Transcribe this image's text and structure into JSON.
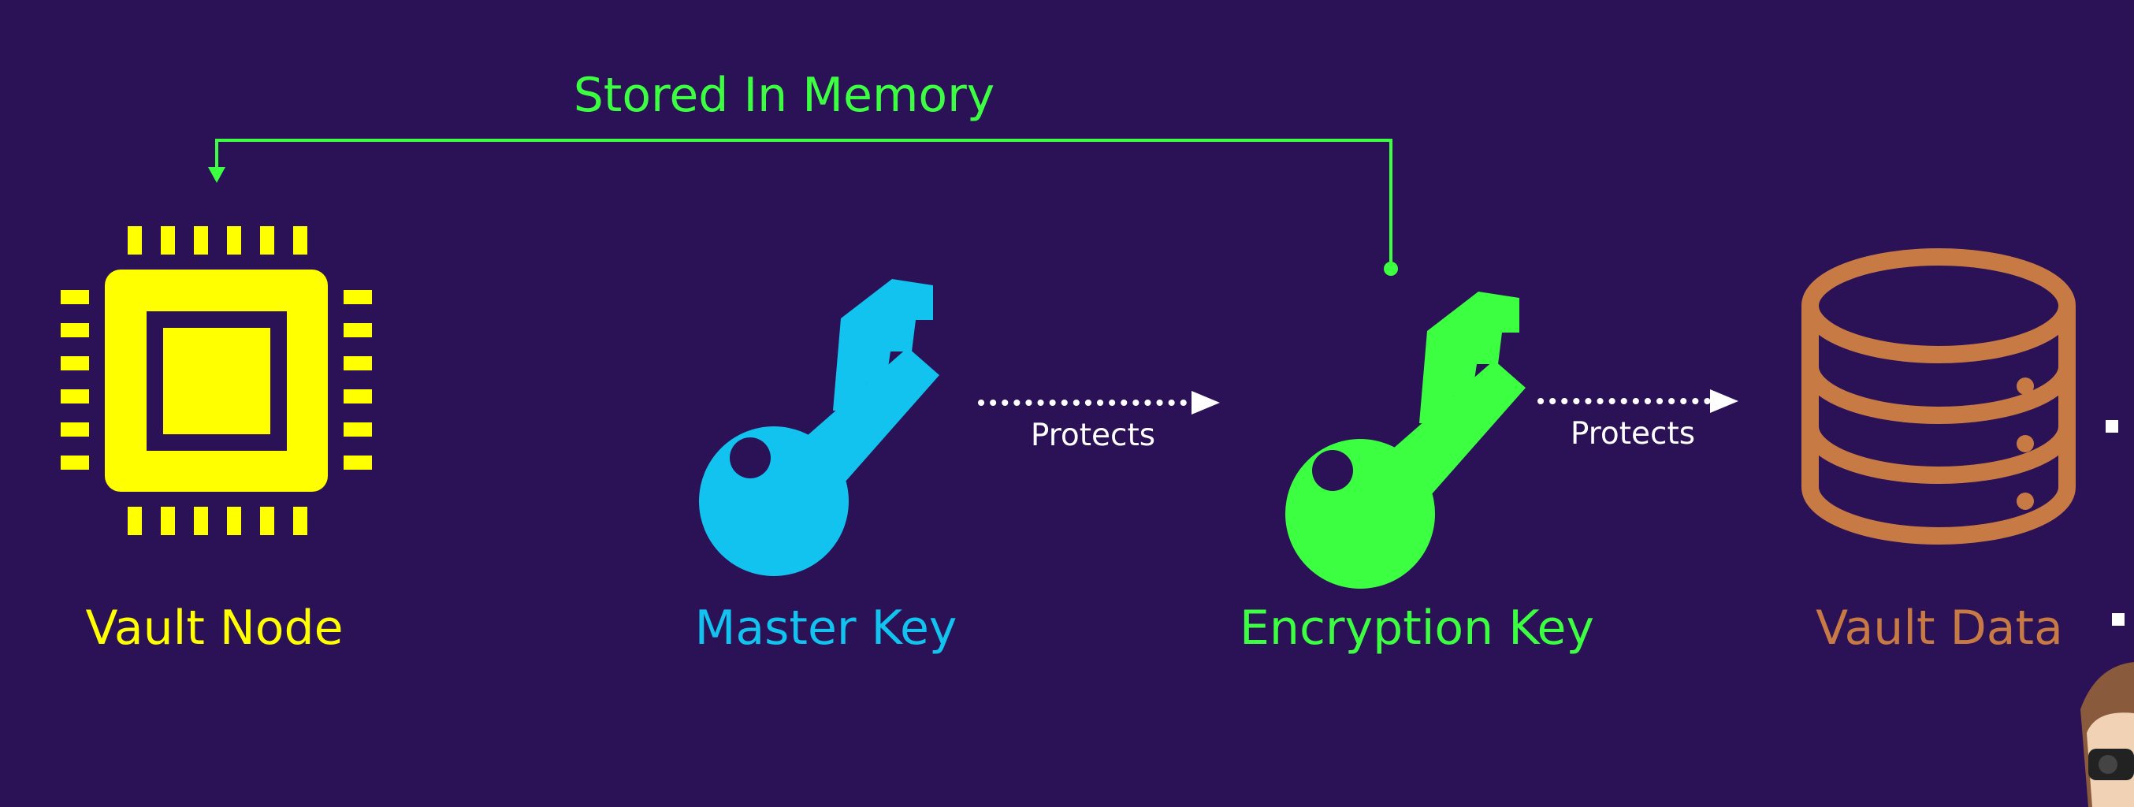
{
  "colors": {
    "background": "#2b1155",
    "chip": "#ffff00",
    "master_key": "#13c3ef",
    "encryption_key": "#3dff42",
    "vault_data": "#c87a44",
    "memory_link": "#3dff42",
    "arrows": "#ffffff"
  },
  "nodes": {
    "vault_node": {
      "label": "Vault Node",
      "icon": "cpu-chip-icon"
    },
    "master_key": {
      "label": "Master Key",
      "icon": "key-icon"
    },
    "encryption_key": {
      "label": "Encryption Key",
      "icon": "key-icon"
    },
    "vault_data": {
      "label": "Vault Data",
      "icon": "database-icon"
    }
  },
  "edges": {
    "master_to_encryption": {
      "label": "Protects"
    },
    "encryption_to_data": {
      "label": "Protects"
    },
    "memory_link": {
      "label": "Stored In Memory"
    }
  }
}
